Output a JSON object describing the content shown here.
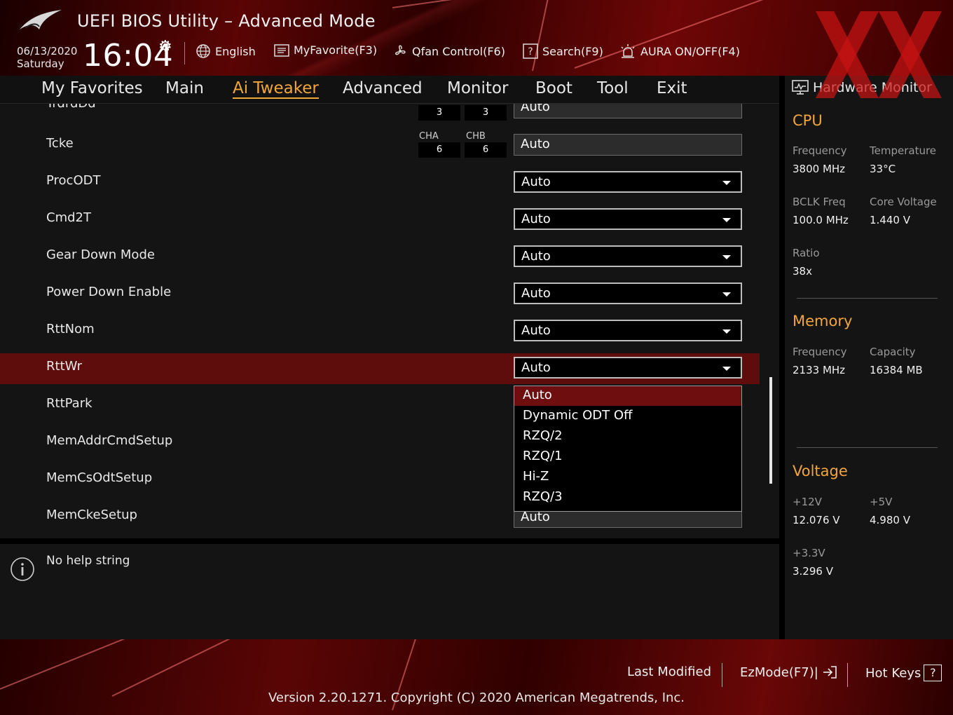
{
  "header": {
    "title": "UEFI BIOS Utility – Advanced Mode",
    "date": "06/13/2020",
    "day": "Saturday",
    "time": "16:04",
    "tools": {
      "language": "English",
      "favorite": "MyFavorite(F3)",
      "qfan": "Qfan Control(F6)",
      "search": "Search(F9)",
      "aura": "AURA ON/OFF(F4)"
    }
  },
  "nav": {
    "tabs": [
      "My Favorites",
      "Main",
      "Ai Tweaker",
      "Advanced",
      "Monitor",
      "Boot",
      "Tool",
      "Exit"
    ],
    "active": "Ai Tweaker"
  },
  "settings": {
    "partial": {
      "label": "TrdrdDd",
      "value": "Auto",
      "cha": "3",
      "chb": "3"
    },
    "tcke": {
      "label": "Tcke",
      "value": "Auto",
      "cha_label": "CHA",
      "chb_label": "CHB",
      "cha": "6",
      "chb": "6"
    },
    "rows": [
      {
        "label": "ProcODT",
        "value": "Auto"
      },
      {
        "label": "Cmd2T",
        "value": "Auto"
      },
      {
        "label": "Gear Down Mode",
        "value": "Auto"
      },
      {
        "label": "Power Down Enable",
        "value": "Auto"
      },
      {
        "label": "RttNom",
        "value": "Auto"
      },
      {
        "label": "RttWr",
        "value": "Auto"
      },
      {
        "label": "RttPark",
        "value": ""
      },
      {
        "label": "MemAddrCmdSetup",
        "value": ""
      },
      {
        "label": "MemCsOdtSetup",
        "value": ""
      },
      {
        "label": "MemCkeSetup",
        "value": "Auto"
      }
    ],
    "selected": "RttWr",
    "dropdown_options": [
      "Auto",
      "Dynamic ODT Off",
      "RZQ/2",
      "RZQ/1",
      "Hi-Z",
      "RZQ/3"
    ],
    "dropdown_highlight": "Auto"
  },
  "help": {
    "text": "No help string"
  },
  "hw_monitor": {
    "title": "Hardware Monitor",
    "cpu": {
      "heading": "CPU",
      "frequency_label": "Frequency",
      "frequency": "3800 MHz",
      "temperature_label": "Temperature",
      "temperature": "33°C",
      "bclk_label": "BCLK Freq",
      "bclk": "100.0 MHz",
      "core_voltage_label": "Core Voltage",
      "core_voltage": "1.440 V",
      "ratio_label": "Ratio",
      "ratio": "38x"
    },
    "memory": {
      "heading": "Memory",
      "frequency_label": "Frequency",
      "frequency": "2133 MHz",
      "capacity_label": "Capacity",
      "capacity": "16384 MB"
    },
    "voltage": {
      "heading": "Voltage",
      "v12_label": "+12V",
      "v12": "12.076 V",
      "v5_label": "+5V",
      "v5": "4.980 V",
      "v33_label": "+3.3V",
      "v33": "3.296 V"
    }
  },
  "footer": {
    "last_modified": "Last Modified",
    "ezmode": "EzMode(F7)|",
    "hotkeys": "Hot Keys",
    "hotkeys_glyph": "?",
    "version": "Version 2.20.1271. Copyright (C) 2020 American Megatrends, Inc."
  },
  "colors": {
    "accent": "#f2a63a",
    "selected_row": "#5e0c0c",
    "brand_red": "#6e0606"
  }
}
